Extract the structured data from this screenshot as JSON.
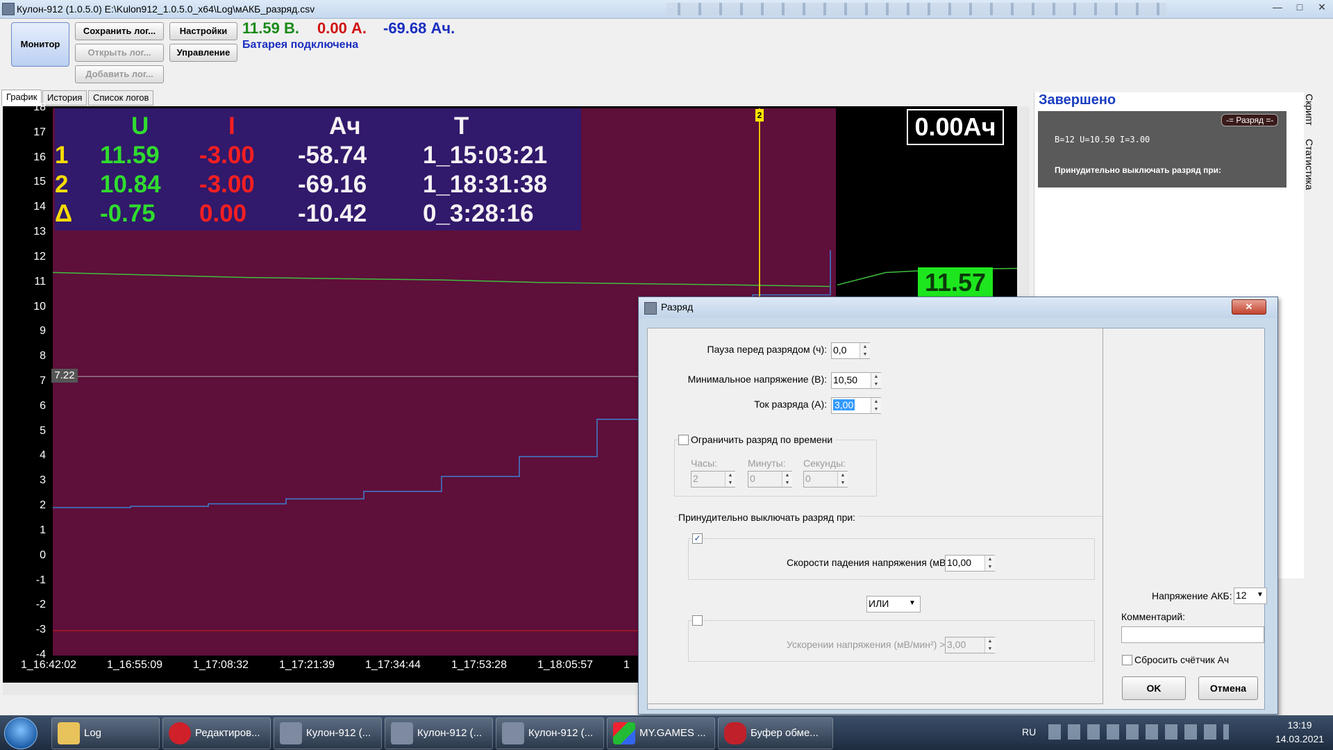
{
  "window": {
    "title": "Кулон-912 (1.0.5.0) E:\\Kulon912_1.0.5.0_x64\\Log\\мАКБ_разряд.csv",
    "min": "—",
    "max": "□",
    "close": "✕"
  },
  "toolbar": {
    "monitor": "Монитор",
    "save_log": "Сохранить лог...",
    "open_log": "Открыть лог...",
    "add_log": "Добавить лог...",
    "settings": "Настройки",
    "control": "Управление",
    "voltage": "11.59 В.",
    "current": "0.00 А.",
    "ah": "-69.68 Ач.",
    "status": "Батарея подключена"
  },
  "tabs": [
    "График",
    "История",
    "Список логов"
  ],
  "chart_overlay": {
    "headers": [
      "U",
      "I",
      "Ач",
      "T"
    ],
    "rows": [
      {
        "label": "1",
        "u": "11.59",
        "i": "-3.00",
        "ah": "-58.74",
        "t": "1_15:03:21"
      },
      {
        "label": "2",
        "u": "10.84",
        "i": "-3.00",
        "ah": "-69.16",
        "t": "1_18:31:38"
      },
      {
        "label": "Δ",
        "u": "-0.75",
        "i": "0.00",
        "ah": "-10.42",
        "t": "0_3:28:16"
      }
    ],
    "ah_badge": "0.00Ач",
    "marker_label": "2",
    "level_label": "7.22",
    "value_badge": "11.57"
  },
  "chart_data": {
    "type": "line",
    "y_ticks": [
      "18",
      "17",
      "16",
      "15",
      "14",
      "13",
      "12",
      "11",
      "10",
      "9",
      "8",
      "7",
      "6",
      "5",
      "4",
      "3",
      "2",
      "1",
      "0",
      "-1",
      "-2",
      "-3",
      "-4"
    ],
    "ylim": [
      -4,
      18
    ],
    "x_ticks": [
      "1_16:42:02",
      "1_16:55:09",
      "1_17:08:32",
      "1_17:21:39",
      "1_17:34:44",
      "1_17:53:28",
      "1_18:05:57",
      "1"
    ],
    "series": [
      {
        "color": "#3fbf3f",
        "values": [
          11.4,
          11.3,
          11.2,
          11.15,
          11.1,
          11.0,
          10.95,
          10.9,
          10.84
        ]
      },
      {
        "color": "#3f7fcf",
        "values": [
          1.95,
          2.0,
          2.1,
          2.3,
          2.6,
          3.2,
          4.0,
          5.5,
          7.8,
          10.5,
          12.3
        ]
      }
    ],
    "reference_lines": [
      7.22,
      -3.0
    ],
    "colors": {
      "background": "#5e0f3a",
      "voltage": "#3fbf3f",
      "ah": "#3f7fcf",
      "limit": "#d02020"
    }
  },
  "right_panel": {
    "status": "Завершено",
    "tab_script": "Скрипт",
    "tab_stats": "Статистика",
    "badge": "-= Разряд =-",
    "line1": "B=12 U=10.50 I=3.00",
    "line2": "Принудительно выключать разряд при:"
  },
  "dialog": {
    "title": "Разряд",
    "pause_label": "Пауза перед разрядом (ч):",
    "pause_value": "0,0",
    "minv_label": "Минимальное напряжение (В):",
    "minv_value": "10,50",
    "current_label": "Ток разряда (А):",
    "current_value": "3,00",
    "limit_time_label": "Ограничить разряд по времени",
    "hours_label": "Часы:",
    "hours_value": "2",
    "minutes_label": "Минуты:",
    "minutes_value": "0",
    "seconds_label": "Секунды:",
    "seconds_value": "0",
    "force_off_label": "Принудительно выключать разряд при:",
    "drop_rate_label": "Скорости падения напряжения (мВ/мин) >",
    "drop_rate_value": "10,00",
    "or_option": "ИЛИ",
    "accel_label": "Ускорении напряжения (мВ/мин²) >",
    "accel_value": "3,00",
    "battery_voltage_label": "Напряжение АКБ:",
    "battery_voltage_value": "12",
    "comment_label": "Комментарий:",
    "comment_value": "",
    "reset_ah_label": "Сбросить счётчик Ач",
    "ok": "OK",
    "cancel": "Отмена"
  },
  "taskbar": {
    "items": [
      "Log",
      "Редактиров...",
      "Кулон-912 (...",
      "Кулон-912 (...",
      "Кулон-912 (...",
      "MY.GAMES ...",
      "Буфер обме..."
    ],
    "lang": "RU",
    "time": "13:19",
    "date": "14.03.2021"
  }
}
